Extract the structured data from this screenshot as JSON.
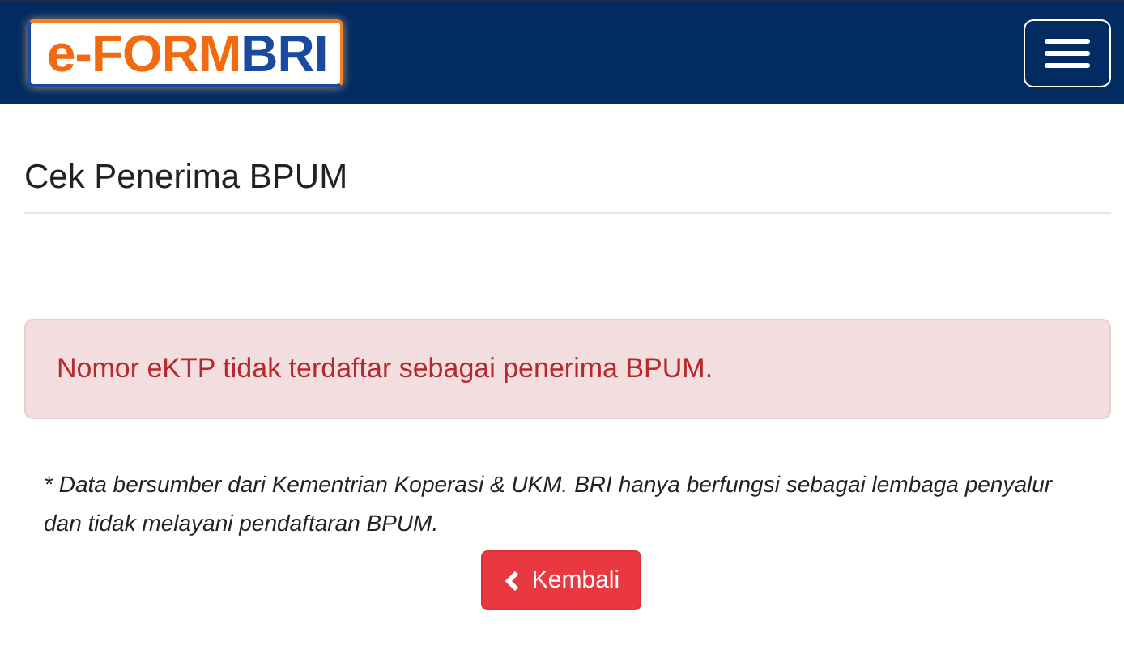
{
  "navbar": {
    "logo": {
      "prefix": "e-FORM",
      "suffix": "BRI"
    }
  },
  "page": {
    "title": "Cek Penerima BPUM"
  },
  "alert": {
    "kind": "danger",
    "message": "Nomor eKTP tidak terdaftar sebagai penerima BPUM."
  },
  "note": "* Data bersumber dari Kementrian Koperasi & UKM. BRI hanya berfungsi sebagai lembaga penyalur dan tidak melayani pendaftaran BPUM.",
  "back_button": {
    "label": "Kembali"
  }
}
